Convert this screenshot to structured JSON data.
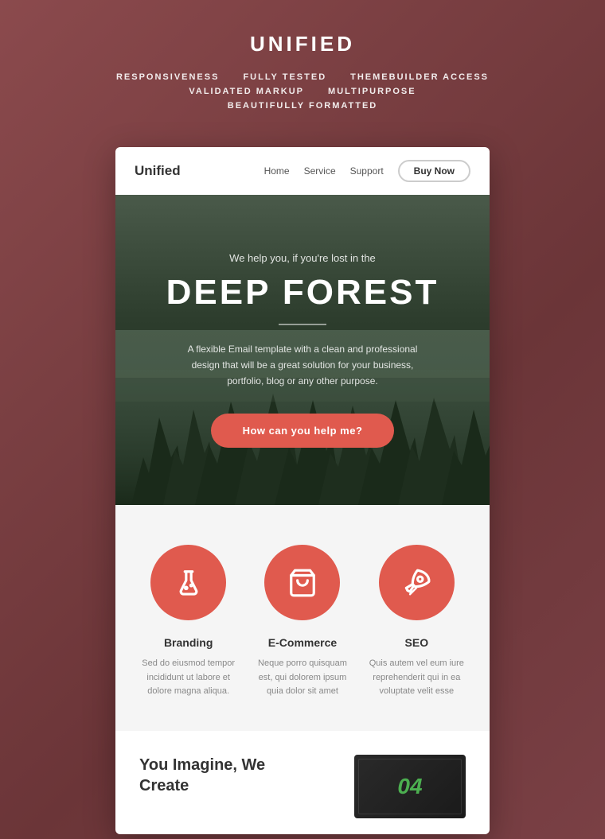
{
  "background": {
    "color": "#7a3f42"
  },
  "header": {
    "title": "UNIFIED",
    "tags": [
      "RESPONSIVENESS",
      "FULLY TESTED",
      "THEMEBUILDER ACCESS",
      "VALIDATED MARKUP",
      "MULTIPURPOSE",
      "BEAUTIFULLY FORMATTED"
    ]
  },
  "card": {
    "nav": {
      "logo": "Unified",
      "links": [
        "Home",
        "Service",
        "Support"
      ],
      "button": "Buy Now"
    },
    "hero": {
      "subtitle": "We help you, if you're lost in the",
      "title": "DEEP FOREST",
      "description": "A flexible Email template with a clean and professional design that will be a great solution for your business, portfolio, blog or any other purpose.",
      "cta": "How can you help me?"
    },
    "services": {
      "items": [
        {
          "icon": "flask-icon",
          "title": "Branding",
          "description": "Sed do eiusmod tempor incididunt ut labore et dolore magna aliqua."
        },
        {
          "icon": "shopping-bag-icon",
          "title": "E-Commerce",
          "description": "Neque porro quisquam est, qui dolorem ipsum quia dolor sit amet"
        },
        {
          "icon": "rocket-icon",
          "title": "SEO",
          "description": "Quis autem vel eum iure reprehenderit qui in ea voluptate velit esse"
        }
      ]
    },
    "bottom": {
      "heading_line1": "You Imagine, We",
      "heading_line2": "Create",
      "image_number": "04"
    }
  }
}
